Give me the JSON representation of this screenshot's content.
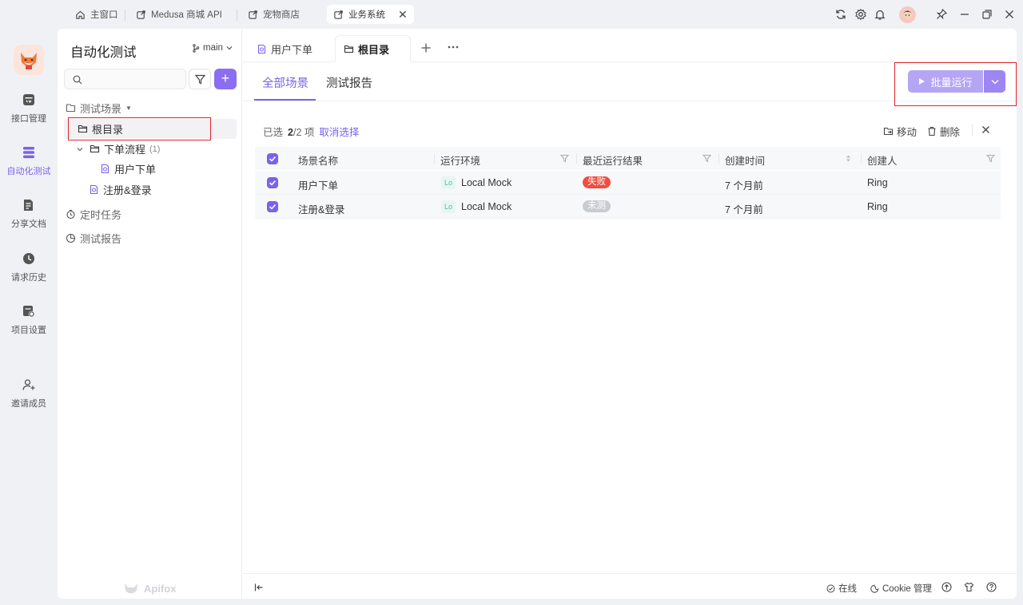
{
  "window_tabs": [
    {
      "label": "主窗口",
      "icon": "home-icon"
    },
    {
      "label": "Medusa 商城 API",
      "icon": "external-doc-icon"
    },
    {
      "label": "宠物商店",
      "icon": "external-doc-icon"
    },
    {
      "label": "业务系统",
      "icon": "external-doc-icon",
      "active": true
    }
  ],
  "leftnav": {
    "items": [
      {
        "label": "接口管理",
        "icon": "api-icon"
      },
      {
        "label": "自动化测试",
        "icon": "automation-icon",
        "active": true
      },
      {
        "label": "分享文档",
        "icon": "share-doc-icon"
      },
      {
        "label": "请求历史",
        "icon": "history-icon"
      },
      {
        "label": "项目设置",
        "icon": "project-settings-icon"
      },
      {
        "label": "邀请成员",
        "icon": "invite-member-icon"
      }
    ]
  },
  "tree": {
    "title": "自动化测试",
    "branch": "main",
    "section_scenarios": "测试场景",
    "root": "根目录",
    "folder_order": "下单流程",
    "folder_order_count": "(1)",
    "item_user_order": "用户下单",
    "item_register_login": "注册&登录",
    "section_scheduled": "定时任务",
    "section_reports": "测试报告",
    "brand": "Apifox"
  },
  "doc_tabs": [
    {
      "label": "用户下单"
    },
    {
      "label": "根目录",
      "active": true
    }
  ],
  "subtabs": {
    "all": "全部场景",
    "report": "测试报告"
  },
  "run_button": "批量运行",
  "selection": {
    "prefix": "已选",
    "count": "2",
    "suffix": "/2 项",
    "cancel": "取消选择",
    "move": "移动",
    "delete": "删除"
  },
  "table": {
    "headers": {
      "name": "场景名称",
      "env": "运行环境",
      "result": "最近运行结果",
      "created": "创建时间",
      "creator": "创建人"
    },
    "rows": [
      {
        "name": "用户下单",
        "env_tag": "Lo",
        "env": "Local Mock",
        "result": "失败",
        "created": "7 个月前",
        "creator": "Ring"
      },
      {
        "name": "注册&登录",
        "env_tag": "Lo",
        "env": "Local Mock",
        "result": "未测",
        "created": "7 个月前",
        "creator": "Ring"
      }
    ]
  },
  "statusbar": {
    "online": "在线",
    "cookie": "Cookie 管理"
  },
  "colors": {
    "accent": "#7b61e8",
    "fail": "#f04d3f",
    "untested": "#c9cbd1",
    "highlight_box": "#e0252b"
  }
}
